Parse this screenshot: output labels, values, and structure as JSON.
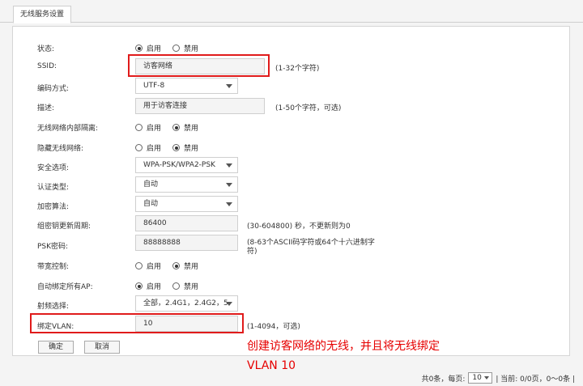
{
  "tab": {
    "label": "无线服务设置"
  },
  "form": {
    "status": {
      "label": "状态:",
      "enable": "启用",
      "disable": "禁用",
      "selected": "enable"
    },
    "ssid": {
      "label": "SSID:",
      "value": "访客网络",
      "hint": "(1-32个字符)"
    },
    "encoding": {
      "label": "编码方式:",
      "value": "UTF-8"
    },
    "description": {
      "label": "描述:",
      "value": "用于访客连接",
      "hint": "(1-50个字符，可选)"
    },
    "isolation": {
      "label": "无线网络内部隔离:",
      "enable": "启用",
      "disable": "禁用",
      "selected": "disable"
    },
    "hide": {
      "label": "隐藏无线网络:",
      "enable": "启用",
      "disable": "禁用",
      "selected": "disable"
    },
    "security": {
      "label": "安全选项:",
      "value": "WPA-PSK/WPA2-PSK"
    },
    "auth": {
      "label": "认证类型:",
      "value": "自动"
    },
    "cipher": {
      "label": "加密算法:",
      "value": "自动"
    },
    "group_key": {
      "label": "组密钥更新周期:",
      "value": "86400",
      "hint": "(30-604800) 秒，不更新则为0"
    },
    "psk": {
      "label": "PSK密码:",
      "value": "88888888",
      "hint_line1": "(8-63个ASCII码字符或64个十六进制字",
      "hint_line2": "符)"
    },
    "bandwidth": {
      "label": "带宽控制:",
      "enable": "启用",
      "disable": "禁用",
      "selected": "disable"
    },
    "auto_bind": {
      "label": "自动绑定所有AP:",
      "enable": "启用",
      "disable": "禁用",
      "selected": "enable"
    },
    "radio_freq": {
      "label": "射频选择:",
      "value": "全部，2.4G1，2.4G2，5"
    },
    "vlan": {
      "label": "绑定VLAN:",
      "value": "10",
      "hint": "(1-4094，可选)"
    }
  },
  "buttons": {
    "confirm": "确定",
    "cancel": "取消"
  },
  "annotation": {
    "line1": "创建访客网络的无线，并且将无线绑定",
    "line2": "VLAN 10"
  },
  "pager": {
    "total": "共0条，每页:",
    "per_page": "10",
    "current": "| 当前: 0/0页，0～0条 |"
  },
  "colors": {
    "highlight": "#e01b1b",
    "annotation": "#e60000"
  }
}
